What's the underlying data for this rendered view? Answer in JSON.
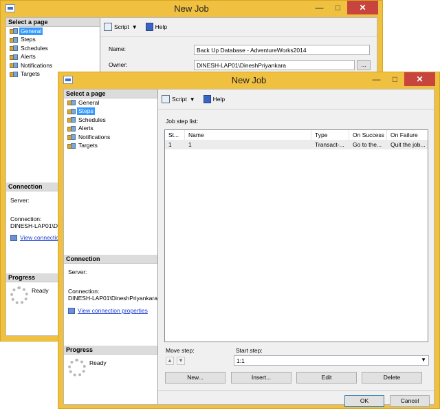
{
  "back_window": {
    "title": "New Job",
    "left": {
      "header": "Select a page",
      "pages": [
        {
          "label": "General",
          "selected": true
        },
        {
          "label": "Steps"
        },
        {
          "label": "Schedules"
        },
        {
          "label": "Alerts"
        },
        {
          "label": "Notifications"
        },
        {
          "label": "Targets"
        }
      ],
      "connection_header": "Connection",
      "server_label": "Server:",
      "connection_label": "Connection:",
      "connection_value": "DINESH-LAP01\\Di",
      "view_link": "View connectio",
      "progress_header": "Progress",
      "progress_status": "Ready"
    },
    "toolbar": {
      "script": "Script",
      "help": "Help"
    },
    "form": {
      "name_label": "Name:",
      "name_value": "Back Up Database - AdventureWorks2014",
      "owner_label": "Owner:",
      "owner_value": "DINESH-LAP01\\DineshPriyankara",
      "browse": "..."
    }
  },
  "front_window": {
    "title": "New Job",
    "left": {
      "header": "Select a page",
      "pages": [
        {
          "label": "General"
        },
        {
          "label": "Steps",
          "selected": true
        },
        {
          "label": "Schedules"
        },
        {
          "label": "Alerts"
        },
        {
          "label": "Notifications"
        },
        {
          "label": "Targets"
        }
      ],
      "connection_header": "Connection",
      "server_label": "Server:",
      "connection_label": "Connection:",
      "connection_value": "DINESH-LAP01\\DineshPriyankara",
      "view_link": "View connection properties",
      "progress_header": "Progress",
      "progress_status": "Ready"
    },
    "toolbar": {
      "script": "Script",
      "help": "Help"
    },
    "job_step_list_label": "Job step list:",
    "table": {
      "columns": [
        "St...",
        "Name",
        "Type",
        "On Success",
        "On Failure"
      ],
      "rows": [
        [
          "1",
          "1",
          "Transact-...",
          "Go to the...",
          "Quit the job..."
        ]
      ]
    },
    "move_step_label": "Move step:",
    "start_step_label": "Start step:",
    "start_step_value": "1:1",
    "buttons": {
      "new": "New...",
      "insert": "Insert...",
      "edit": "Edit",
      "delete": "Delete",
      "ok": "OK",
      "cancel": "Cancel"
    }
  },
  "colors": {
    "title_bar": "#f0c040",
    "selection": "#3399ff",
    "close_button": "#c7453d",
    "link": "#1a3fd0"
  }
}
